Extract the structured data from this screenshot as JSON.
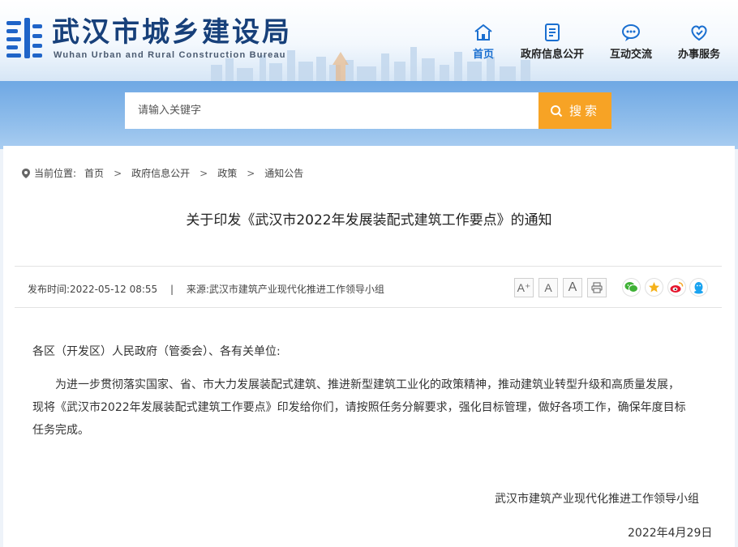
{
  "header": {
    "title": "武汉市城乡建设局",
    "subtitle": "Wuhan Urban and Rural Construction Bureau",
    "nav": [
      {
        "label": "首页",
        "icon": "home-icon",
        "active": true
      },
      {
        "label": "政府信息公开",
        "icon": "document-icon",
        "active": false
      },
      {
        "label": "互动交流",
        "icon": "chat-icon",
        "active": false
      },
      {
        "label": "办事服务",
        "icon": "service-icon",
        "active": false
      }
    ]
  },
  "search": {
    "placeholder": "请输入关键字",
    "button_label": "搜索"
  },
  "breadcrumb": {
    "prefix": "当前位置:",
    "items": [
      "首页",
      "政府信息公开",
      "政策",
      "通知公告"
    ]
  },
  "article": {
    "title": "关于印发《武汉市2022年发展装配式建筑工作要点》的通知",
    "publish_time": "发布时间:2022-05-12 08:55",
    "source": "来源:武汉市建筑产业现代化推进工作领导小组",
    "salutation": "各区（开发区）人民政府（管委会）、各有关单位:",
    "paragraph_lines": [
      "为进一步贯彻落实国家、省、市大力发展装配式建筑、推进新型建筑工业化的政策精神，推动建筑业转型升级和高质量发展，",
      "现将《武汉市2022年发展装配式建筑工作要点》印发给你们，请按照任务分解要求，强化目标管理，做好各项工作，确保年度目标",
      "任务完成。"
    ],
    "signature": "武汉市建筑产业现代化推进工作领导小组",
    "date": "2022年4月29日"
  },
  "tools": [
    {
      "icon": "font-increase-icon",
      "label": "A⁺"
    },
    {
      "icon": "font-reset-icon",
      "label": "A"
    },
    {
      "icon": "font-decrease-icon",
      "label": "A"
    },
    {
      "icon": "print-icon",
      "label": ""
    }
  ],
  "share_icons": [
    "wechat-icon",
    "qzone-icon",
    "weibo-icon",
    "qq-icon"
  ],
  "colors": {
    "brand_blue": "#17407a",
    "nav_active": "#1a6fd0",
    "search_button": "#f7a325",
    "band": "#8fbdeb"
  }
}
